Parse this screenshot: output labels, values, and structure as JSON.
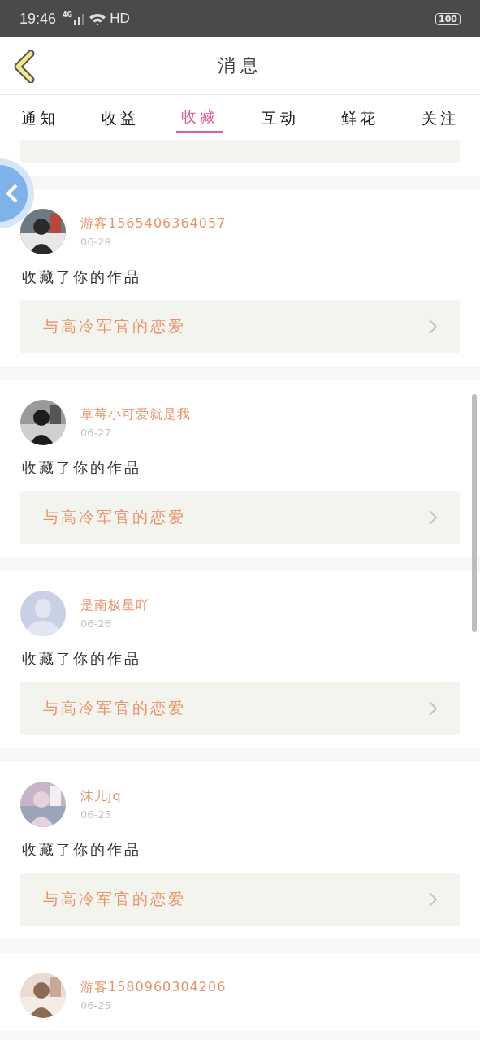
{
  "status_bar": {
    "time": "19:46",
    "network": "4G",
    "wifi_label": "HD",
    "battery": "100"
  },
  "header": {
    "title": "消息"
  },
  "tabs": [
    {
      "label": "通知",
      "selected": false
    },
    {
      "label": "收益",
      "selected": false
    },
    {
      "label": "收藏",
      "selected": true
    },
    {
      "label": "互动",
      "selected": false
    },
    {
      "label": "鲜花",
      "selected": false
    },
    {
      "label": "关注",
      "selected": false
    }
  ],
  "messages": [
    {
      "user": "游客1565406364057",
      "date": "06-28",
      "action": "收藏了你的作品",
      "book": "与高冷军官的恋爱"
    },
    {
      "user": "草莓小可爱就是我",
      "date": "06-27",
      "action": "收藏了你的作品",
      "book": "与高冷军官的恋爱"
    },
    {
      "user": "是南极星吖",
      "date": "06-26",
      "action": "收藏了你的作品",
      "book": "与高冷军官的恋爱",
      "avatar": {
        "kind": "default"
      }
    },
    {
      "user": "沫儿jq",
      "date": "06-25",
      "action": "收藏了你的作品",
      "book": "与高冷军官的恋爱"
    },
    {
      "user": "游客1580960304206",
      "date": "06-25"
    }
  ]
}
